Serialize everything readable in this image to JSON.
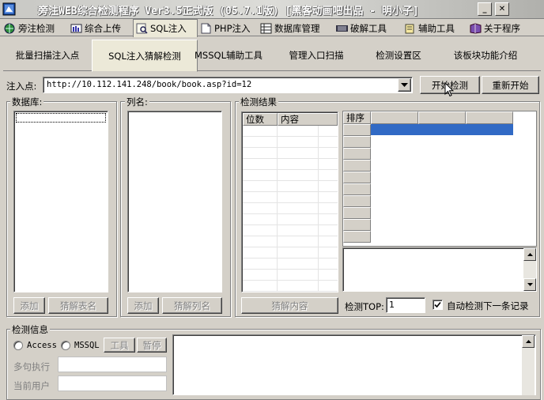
{
  "window": {
    "title": "旁注WEB综合检测程序 Ver3.5正式版 (05.7.1版) [黑客动画吧出品 - 明小子]",
    "minimize_glyph": "_",
    "close_glyph": "✕"
  },
  "main_tabs": [
    {
      "label": "旁注检测",
      "icon": "globe-icon"
    },
    {
      "label": "综合上传",
      "icon": "upload-icon"
    },
    {
      "label": "SQL注入",
      "icon": "database-search-icon"
    },
    {
      "label": "PHP注入",
      "icon": "php-page-icon"
    },
    {
      "label": "数据库管理",
      "icon": "database-icon"
    },
    {
      "label": "破解工具",
      "icon": "keyboard-icon"
    },
    {
      "label": "辅助工具",
      "icon": "toolbox-icon"
    },
    {
      "label": "关于程序",
      "icon": "book-icon"
    }
  ],
  "sub_tabs": [
    {
      "label": "批量扫描注入点"
    },
    {
      "label": "SQL注入猜解检测"
    },
    {
      "label": "MSSQL辅助工具"
    },
    {
      "label": "管理入口扫描"
    },
    {
      "label": "检测设置区"
    },
    {
      "label": "该板块功能介绍"
    }
  ],
  "injection": {
    "label": "注入点:",
    "url": "http://10.112.141.248/book/book.asp?id=12",
    "start_button": "开始检测",
    "restart_button": "重新开始"
  },
  "database_panel": {
    "label": "数据库:",
    "add_button": "添加",
    "guess_tables_button": "猜解表名"
  },
  "columns_panel": {
    "label": "列名:",
    "add_button": "添加",
    "guess_columns_button": "猜解列名"
  },
  "results_panel": {
    "label": "检测结果",
    "columns": [
      "位数",
      "内容"
    ],
    "guess_content_button": "猜解内容",
    "sort_header": "排序",
    "top_label": "检测TOP:",
    "top_value": "1",
    "auto_next_label": "自动检测下一条记录",
    "auto_next_checked": true
  },
  "info_panel": {
    "label": "检测信息",
    "db_options": [
      "Access",
      "MSSQL"
    ],
    "tool_button": "工具",
    "stop_button": "暂停",
    "multi_exec_label": "多句执行",
    "current_user_label": "当前用户"
  },
  "colors": {
    "face": "#d4d0c8",
    "selection": "#316ac5"
  }
}
